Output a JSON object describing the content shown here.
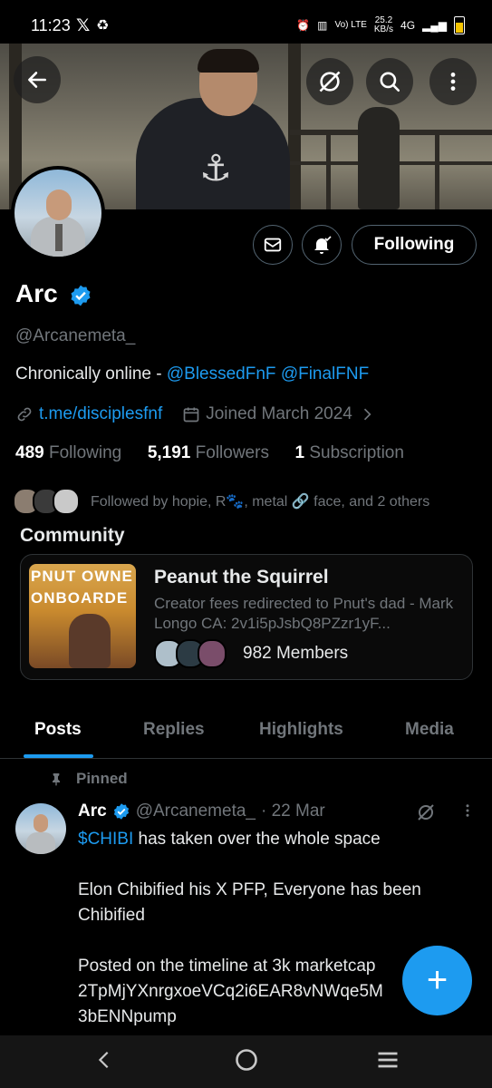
{
  "status_bar": {
    "time": "11:23",
    "x_logo": "𝕏",
    "sync_icon": "♻",
    "network_speed_value": "25.2",
    "network_speed_unit": "KB/s",
    "volte": "Vo) LTE",
    "network": "4G",
    "battery_icon": "battery-low"
  },
  "header": {
    "back_icon": "arrow-left-icon",
    "grok_icon": "grok-icon",
    "search_icon": "search-icon",
    "more_icon": "more-vertical-icon"
  },
  "profile": {
    "name": "Arc",
    "verified": true,
    "handle": "@Arcanemeta_",
    "bio_text": "Chronically online - ",
    "bio_mention_1": "@BlessedFnF",
    "bio_mention_2": "@FinalFNF",
    "link": "t.me/disciplesfnf",
    "joined": "Joined March 2024",
    "following_count": "489",
    "following_label": "Following",
    "followers_count": "5,191",
    "followers_label": "Followers",
    "subscription_count": "1",
    "subscription_label": "Subscription",
    "followed_by": "Followed by hopie, R🐾, metal 🔗 face, and 2 others",
    "follow_button": "Following"
  },
  "community": {
    "section_title": "Community",
    "name": "Peanut the Squirrel",
    "description": "Creator fees redirected to Pnut's dad - Mark Longo CA: 2v1i5pJsbQ8PZzr1yF...",
    "members": "982 Members",
    "thumb_line_1": "PNUT OWNE",
    "thumb_line_2": "ONBOARDE"
  },
  "tabs": [
    {
      "label": "Posts",
      "active": true
    },
    {
      "label": "Replies",
      "active": false
    },
    {
      "label": "Highlights",
      "active": false
    },
    {
      "label": "Media",
      "active": false
    }
  ],
  "post": {
    "pinned_label": "Pinned",
    "author": "Arc",
    "handle": "@Arcanemeta_",
    "date": "· 22 Mar",
    "cashtag": "$CHIBI",
    "line_1_rest": " has taken over the whole space",
    "paragraph_2": "Elon Chibified his X PFP, Everyone has been Chibified",
    "paragraph_3_line_1": "Posted on the timeline at 3k marketcap",
    "paragraph_3_line_2": "2TpMjYXnrgxoeVCq2i6EAR8vNWqe5M",
    "paragraph_3_line_3": "3bENNpump"
  },
  "fab_label": "+",
  "colors": {
    "accent": "#1d9bf0",
    "background": "#000000",
    "muted_text": "#71767b",
    "border": "#2f3336"
  }
}
